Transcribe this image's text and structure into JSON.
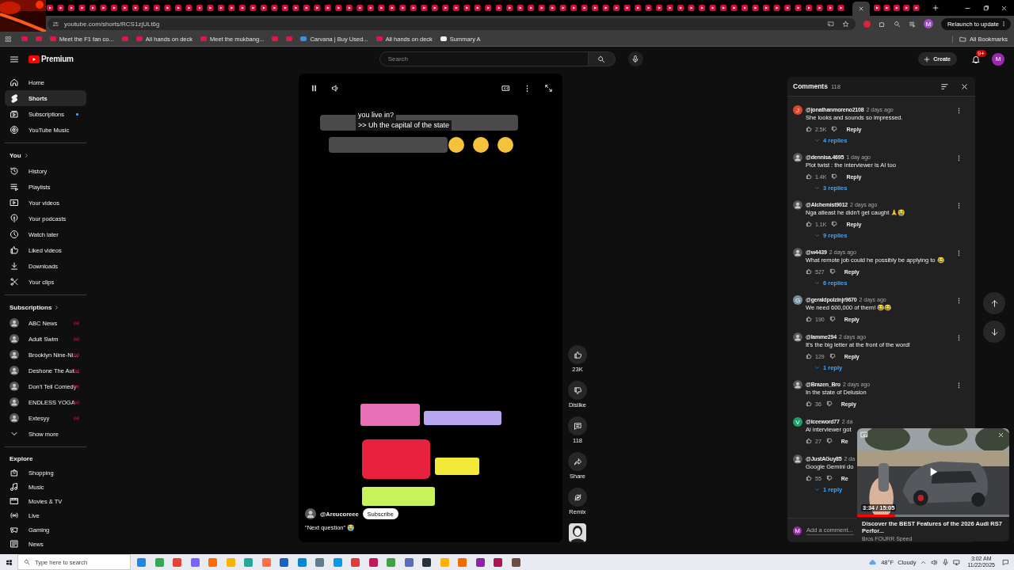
{
  "browser": {
    "url": "youtube.com/shorts/RCS1zjULt6g",
    "profile_initial": "M",
    "relaunch_button": "Relaunch to update",
    "all_bookmarks": "All Bookmarks",
    "bookmarks": [
      {
        "kind": "icon",
        "color": "#e0174a"
      },
      {
        "kind": "icon",
        "color": "#e0174a"
      },
      {
        "kind": "link",
        "label": "Meet the F1 fan co...",
        "color": "#e0174a"
      },
      {
        "kind": "icon",
        "color": "#e0174a"
      },
      {
        "kind": "link",
        "label": "All hands on deck",
        "color": "#e0174a"
      },
      {
        "kind": "link",
        "label": "Meet the mukbang...",
        "color": "#e0174a"
      },
      {
        "kind": "icon",
        "color": "#e0174a"
      },
      {
        "kind": "icon",
        "color": "#e0174a"
      },
      {
        "kind": "link",
        "label": "Carvana | Buy Used...",
        "color": "#3d8fe0"
      },
      {
        "kind": "link",
        "label": "All hands on deck",
        "color": "#e0174a"
      },
      {
        "kind": "link",
        "label": "Summary A",
        "color": "#f2f2f2"
      }
    ]
  },
  "header": {
    "logo": "Premium",
    "search": {
      "placeholder": "Search"
    },
    "create_button": "Create",
    "notification_count": "9+",
    "avatar_initial": "M"
  },
  "sidebar": {
    "sections": [
      {
        "items": [
          {
            "kind": "nav",
            "label": "Home",
            "selected": false,
            "new_content": false
          },
          {
            "kind": "nav",
            "label": "Shorts",
            "selected": true,
            "new_content": false
          },
          {
            "kind": "nav",
            "label": "Subscriptions",
            "selected": false,
            "new_content": true
          },
          {
            "kind": "nav",
            "label": "YouTube Music",
            "selected": false,
            "new_content": false
          }
        ]
      },
      {
        "title": "You",
        "link": true,
        "items": [
          {
            "kind": "nav",
            "label": "History",
            "selected": false,
            "new_content": false
          },
          {
            "kind": "nav",
            "label": "Playlists",
            "selected": false,
            "new_content": false
          },
          {
            "kind": "nav",
            "label": "Your videos",
            "selected": false,
            "new_content": false
          },
          {
            "kind": "nav",
            "label": "Your podcasts",
            "selected": false,
            "new_content": false
          },
          {
            "kind": "nav",
            "label": "Watch later",
            "selected": false,
            "new_content": false
          },
          {
            "kind": "nav",
            "label": "Liked videos",
            "selected": false,
            "new_content": false
          },
          {
            "kind": "nav",
            "label": "Downloads",
            "selected": false,
            "new_content": false
          },
          {
            "kind": "nav",
            "label": "Your clips",
            "selected": false,
            "new_content": false
          }
        ]
      },
      {
        "title": "Subscriptions",
        "link": true,
        "items": [
          {
            "kind": "channel",
            "label": "ABC News",
            "live": true
          },
          {
            "kind": "channel",
            "label": "Adult Swim",
            "live": true
          },
          {
            "kind": "channel",
            "label": "Brooklyn Nine-Ni...",
            "live": true
          },
          {
            "kind": "channel",
            "label": "Deshone The Aut...",
            "live": true
          },
          {
            "kind": "channel",
            "label": "Don't Tell Comedy",
            "live": true
          },
          {
            "kind": "channel",
            "label": "ENDLESS YOGA",
            "live": true
          },
          {
            "kind": "channel",
            "label": "Extesyy",
            "live": true
          },
          {
            "kind": "more",
            "label": "Show more"
          }
        ]
      },
      {
        "title": "Explore",
        "link": false,
        "items": [
          {
            "kind": "nav",
            "label": "Shopping",
            "selected": false,
            "new_content": false
          },
          {
            "kind": "nav",
            "label": "Music",
            "selected": false,
            "new_content": false
          },
          {
            "kind": "nav",
            "label": "Movies & TV",
            "selected": false,
            "new_content": false
          },
          {
            "kind": "nav",
            "label": "Live",
            "selected": false,
            "new_content": false
          },
          {
            "kind": "nav",
            "label": "Gaming",
            "selected": false,
            "new_content": false
          },
          {
            "kind": "nav",
            "label": "News",
            "selected": false,
            "new_content": false
          }
        ]
      }
    ]
  },
  "player": {
    "playing": true,
    "captions": [
      "you live in?",
      ">> Uh the capital of the state"
    ],
    "channel": "@Areucoreee",
    "subscribe_button": "Subscribe",
    "description": "\"Next question\" 😭",
    "actions": [
      {
        "label": "23K"
      },
      {
        "label": "Dislike"
      },
      {
        "label": "118"
      },
      {
        "label": "Share"
      },
      {
        "label": "Remix"
      }
    ]
  },
  "comments": {
    "title": "Comments",
    "count": "118",
    "add_placeholder": "Add a comment...",
    "user_initial": "M",
    "items": [
      {
        "avatar": {
          "kind": "letter",
          "letter": "J",
          "color": "#e0452b"
        },
        "handle": "@jonathanmoreno2108",
        "time": "2 days ago",
        "text": "She looks and sounds so impressed.",
        "likes": "2.5K",
        "reply": "Reply",
        "replies": "4 replies",
        "has_menu": true
      },
      {
        "handle": "@dennisa.4695",
        "time": "1 day ago",
        "text": "Plot twist : the interviewer is AI too",
        "likes": "1.4K",
        "reply": "Reply",
        "replies": "3 replies",
        "has_menu": true
      },
      {
        "handle": "@Alchemist9012",
        "time": "2 days ago",
        "text": "Nga atleast he didn't get caught 🙏😭",
        "likes": "1.1K",
        "reply": "Reply",
        "replies": "9 replies",
        "has_menu": true
      },
      {
        "handle": "@w4439",
        "time": "2 days ago",
        "text": "What remote job could he possibly be applying to 😂",
        "likes": "527",
        "reply": "Reply",
        "replies": "6 replies",
        "has_menu": true
      },
      {
        "avatar": {
          "kind": "letter",
          "letter": "G",
          "color": "#78909c"
        },
        "handle": "@geraldpolzinjr9670",
        "time": "2 days ago",
        "text": "We need 600,000 of them! 😂😂",
        "likes": "190",
        "reply": "Reply",
        "has_menu": true
      },
      {
        "handle": "@lamme294",
        "time": "2 days ago",
        "text": "It's the big letter at the front of the word!",
        "likes": "129",
        "reply": "Reply",
        "replies": "1 reply",
        "has_menu": true
      },
      {
        "handle": "@Brazen_Bro",
        "time": "2 days ago",
        "text": "In the state of Delusion",
        "likes": "36",
        "reply": "Reply",
        "has_menu": true
      },
      {
        "avatar": {
          "kind": "letter",
          "letter": "V",
          "color": "#1e9e6a"
        },
        "handle": "@iceeword77",
        "time": "2 da",
        "text": "Ai interviewer got",
        "likes": "27",
        "reply": "Re",
        "has_menu": false
      },
      {
        "handle": "@JustAGuy85",
        "time": "2 da",
        "text": "Google Gemini do",
        "likes": "55",
        "reply": "Re",
        "replies": "1 reply"
      }
    ]
  },
  "mini_player": {
    "time": "3:34 / 15:05",
    "level": 0.25,
    "title": "Discover the BEST Features of the 2026 Audi RS7 Perfor...",
    "channel": "Bros FOURR Speed"
  },
  "taskbar": {
    "search_placeholder": "Type here to search",
    "temperature": "48°F",
    "weather": "Cloudy",
    "time": "3:02 AM",
    "date": "11/22/2025"
  }
}
